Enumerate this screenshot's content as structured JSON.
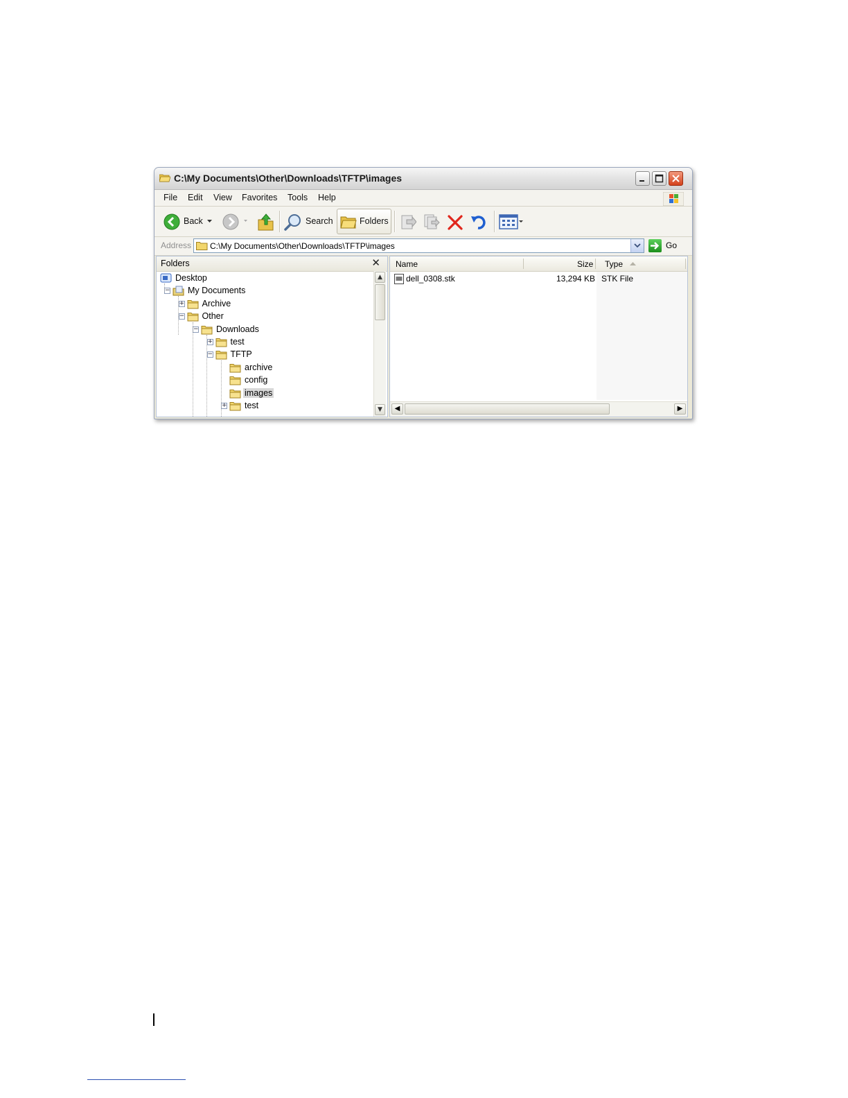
{
  "window": {
    "title": "C:\\My Documents\\Other\\Downloads\\TFTP\\images"
  },
  "menu": [
    "File",
    "Edit",
    "View",
    "Favorites",
    "Tools",
    "Help"
  ],
  "toolbar": {
    "back_label": "Back",
    "search_label": "Search",
    "folders_label": "Folders"
  },
  "address": {
    "label": "Address",
    "value": "C:\\My Documents\\Other\\Downloads\\TFTP\\images",
    "go_label": "Go"
  },
  "folders_pane": {
    "title": "Folders",
    "close_glyph": "✕",
    "tree": [
      {
        "label": "Desktop",
        "level": 0,
        "expander": "",
        "icon": "desktop-icon"
      },
      {
        "label": "My Documents",
        "level": 1,
        "expander": "−",
        "icon": "my-documents-icon"
      },
      {
        "label": "Archive",
        "level": 2,
        "expander": "+",
        "icon": "folder-icon"
      },
      {
        "label": "Other",
        "level": 2,
        "expander": "−",
        "icon": "folder-icon"
      },
      {
        "label": "Downloads",
        "level": 3,
        "expander": "−",
        "icon": "folder-icon"
      },
      {
        "label": "test",
        "level": 4,
        "expander": "+",
        "icon": "folder-icon"
      },
      {
        "label": "TFTP",
        "level": 4,
        "expander": "−",
        "icon": "folder-icon"
      },
      {
        "label": "archive",
        "level": 5,
        "expander": "",
        "icon": "folder-icon"
      },
      {
        "label": "config",
        "level": 5,
        "expander": "",
        "icon": "folder-icon"
      },
      {
        "label": "images",
        "level": 5,
        "expander": "",
        "icon": "folder-icon",
        "selected": true
      },
      {
        "label": "test",
        "level": 5,
        "expander": "+",
        "icon": "folder-icon"
      }
    ]
  },
  "files_pane": {
    "columns": [
      "Name",
      "Size",
      "Type"
    ],
    "rows": [
      {
        "name": "dell_0308.stk",
        "size": "13,294 KB",
        "type": "STK File"
      }
    ]
  },
  "colors": {
    "selection": "#d8d8d8",
    "close_button": "#d4421c",
    "go_button": "#1c8e1c",
    "address_border": "#7f9db9"
  }
}
